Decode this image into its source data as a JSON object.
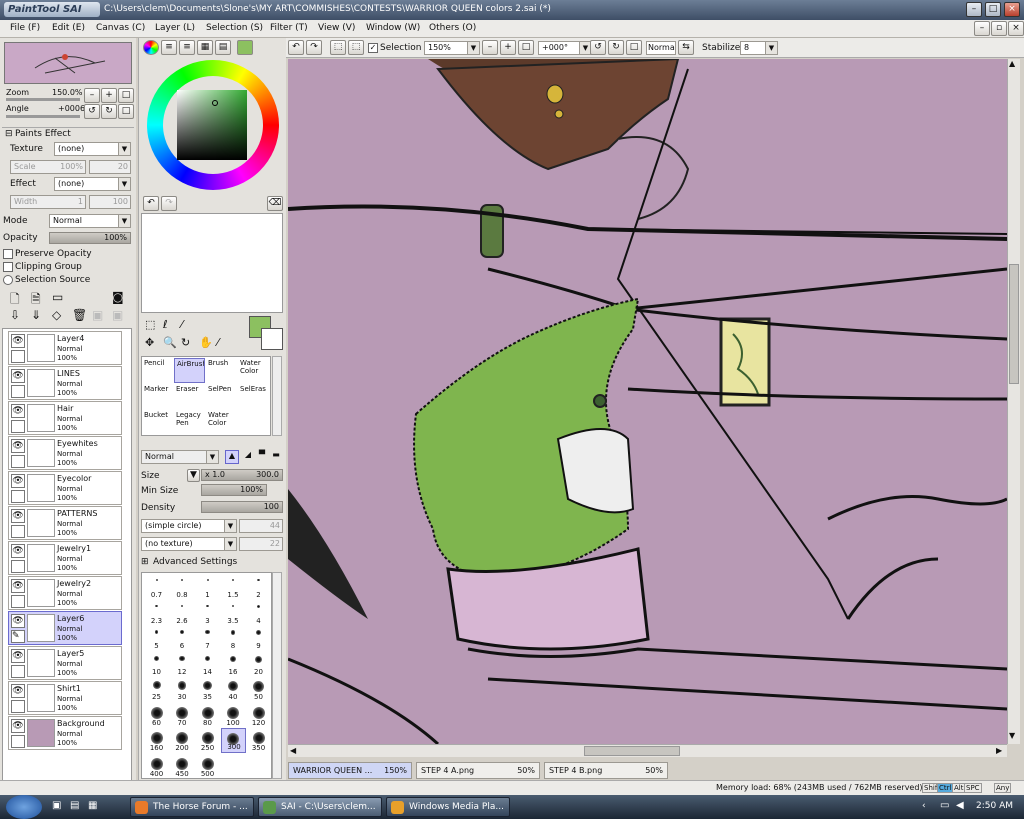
{
  "title": {
    "app": "PaintTool SAI",
    "path": "C:\\Users\\clem\\Documents\\Slone's\\MY ART\\COMMISHES\\CONTESTS\\WARRIOR QUEEN colors 2.sai (*)"
  },
  "menu": [
    "File (F)",
    "Edit (E)",
    "Canvas (C)",
    "Layer (L)",
    "Selection (S)",
    "Filter (T)",
    "View (V)",
    "Window (W)",
    "Others (O)"
  ],
  "navigator": {
    "zoom_label": "Zoom",
    "zoom_value": "150.0%",
    "angle_label": "Angle",
    "angle_value": "+0006"
  },
  "paints_effect": {
    "header": "Paints Effect",
    "texture_label": "Texture",
    "texture_value": "(none)",
    "scale_label": "Scale",
    "scale_value": "100%",
    "scale_num": "20",
    "effect_label": "Effect",
    "effect_value": "(none)",
    "width_label": "Width",
    "width_value": "1",
    "width_num": "100"
  },
  "layer_props": {
    "mode_label": "Mode",
    "mode_value": "Normal",
    "opacity_label": "Opacity",
    "opacity_value": "100%",
    "preserve": "Preserve Opacity",
    "clipping": "Clipping Group",
    "selsrc": "Selection Source"
  },
  "layers": [
    {
      "name": "Layer4",
      "mode": "Normal",
      "opacity": "100%"
    },
    {
      "name": "LINES",
      "mode": "Normal",
      "opacity": "100%"
    },
    {
      "name": "Hair",
      "mode": "Normal",
      "opacity": "100%"
    },
    {
      "name": "Eyewhites",
      "mode": "Normal",
      "opacity": "100%"
    },
    {
      "name": "Eyecolor",
      "mode": "Normal",
      "opacity": "100%"
    },
    {
      "name": "PATTERNS",
      "mode": "Normal",
      "opacity": "100%"
    },
    {
      "name": "Jewelry1",
      "mode": "Normal",
      "opacity": "100%"
    },
    {
      "name": "Jewelry2",
      "mode": "Normal",
      "opacity": "100%"
    },
    {
      "name": "Layer6",
      "mode": "Normal",
      "opacity": "100%"
    },
    {
      "name": "Layer5",
      "mode": "Normal",
      "opacity": "100%"
    },
    {
      "name": "Shirt1",
      "mode": "Normal",
      "opacity": "100%"
    },
    {
      "name": "Background",
      "mode": "Normal",
      "opacity": "100%"
    }
  ],
  "selected_layer": "Layer6",
  "tools": [
    {
      "name": "Pencil"
    },
    {
      "name": "AirBrush"
    },
    {
      "name": "Brush"
    },
    {
      "name": "Water Color"
    },
    {
      "name": "Marker"
    },
    {
      "name": "Eraser"
    },
    {
      "name": "SelPen"
    },
    {
      "name": "SelEras"
    },
    {
      "name": "Bucket"
    },
    {
      "name": "Legacy Pen"
    },
    {
      "name": "Water Color"
    }
  ],
  "selected_tool": "AirBrush",
  "brush": {
    "mode": "Normal",
    "size_label": "Size",
    "size_mult": "x 1.0",
    "size_value": "300.0",
    "minsize_label": "Min Size",
    "minsize_value": "100%",
    "density_label": "Density",
    "density_value": "100",
    "shape": "(simple circle)",
    "shape_num": "44",
    "texture": "(no texture)",
    "texture_num": "22",
    "advanced": "Advanced Settings"
  },
  "brush_sizes": [
    "0.7",
    "0.8",
    "1",
    "1.5",
    "2",
    "2.3",
    "2.6",
    "3",
    "3.5",
    "4",
    "5",
    "6",
    "7",
    "8",
    "9",
    "10",
    "12",
    "14",
    "16",
    "20",
    "25",
    "30",
    "35",
    "40",
    "50",
    "60",
    "70",
    "80",
    "100",
    "120",
    "160",
    "200",
    "250",
    "300",
    "350",
    "400",
    "450",
    "500"
  ],
  "selected_size": "300",
  "canvas_toolbar": {
    "selection": "Selection",
    "zoom": "150%",
    "angle": "+000°",
    "mode": "Normal",
    "stabilizer_label": "Stabilizer",
    "stabilizer_value": "8"
  },
  "tabs": [
    {
      "name": "WARRIOR QUEEN ...",
      "pct": "150%"
    },
    {
      "name": "STEP 4 A.png",
      "pct": "50%"
    },
    {
      "name": "STEP 4 B.png",
      "pct": "50%"
    }
  ],
  "status": {
    "memory": "Memory load: 68% (243MB used / 762MB reserved)",
    "keys": [
      "Shift",
      "Ctrl",
      "Alt",
      "SPC",
      "Any"
    ]
  },
  "taskbar": {
    "items": [
      "The Horse Forum - ...",
      "SAI - C:\\Users\\clem...",
      "Windows Media Pla..."
    ],
    "clock": "2:50 AM"
  },
  "colors": {
    "canvas_bg": "#b89ab5",
    "green": "#8cc060",
    "accent": "#d3d2fb"
  }
}
